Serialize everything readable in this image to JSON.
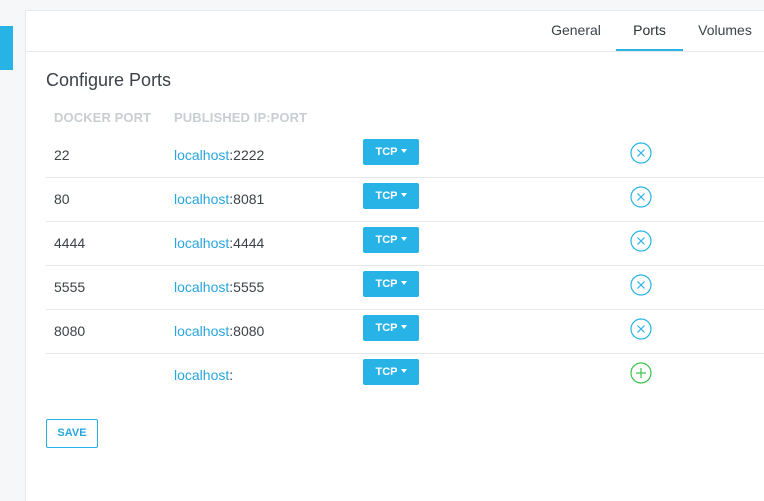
{
  "tabs": [
    {
      "label": "General",
      "active": false
    },
    {
      "label": "Ports",
      "active": true
    },
    {
      "label": "Volumes",
      "active": false
    }
  ],
  "section_title": "Configure Ports",
  "columns": {
    "docker_port": "DOCKER PORT",
    "published": "PUBLISHED IP:PORT"
  },
  "rows": [
    {
      "docker_port": "22",
      "host": "localhost",
      "port": ":2222",
      "protocol": "TCP",
      "action": "remove-icon"
    },
    {
      "docker_port": "80",
      "host": "localhost",
      "port": ":8081",
      "protocol": "TCP",
      "action": "remove-icon"
    },
    {
      "docker_port": "4444",
      "host": "localhost",
      "port": ":4444",
      "protocol": "TCP",
      "action": "remove-icon"
    },
    {
      "docker_port": "5555",
      "host": "localhost",
      "port": ":5555",
      "protocol": "TCP",
      "action": "remove-icon"
    },
    {
      "docker_port": "8080",
      "host": "localhost",
      "port": ":8080",
      "protocol": "TCP",
      "action": "remove-icon"
    },
    {
      "docker_port": "",
      "host": "localhost",
      "port": ":",
      "protocol": "TCP",
      "action": "add-icon"
    }
  ],
  "save_label": "SAVE",
  "colors": {
    "accent": "#27b3e6",
    "link": "#27a6de",
    "add": "#3cc24a",
    "header_text": "#c9ced3"
  }
}
